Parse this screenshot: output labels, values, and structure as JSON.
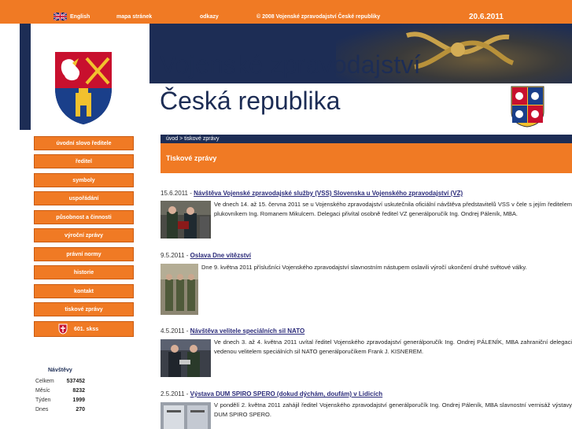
{
  "topbar": {
    "language_label": "English",
    "sitemap_label": "mapa stránek",
    "links_label": "odkazy",
    "copyright": "© 2008 Vojenské zpravodajství České republiky",
    "date": "20.6.2011"
  },
  "header": {
    "title_line1": "Vojenské zpravodajství",
    "title_line2": "Česká republika"
  },
  "nav": {
    "items": [
      {
        "label": "úvodní slovo ředitele"
      },
      {
        "label": "ředitel"
      },
      {
        "label": "symboly"
      },
      {
        "label": "uspořádání"
      },
      {
        "label": "působnost a činnosti"
      },
      {
        "label": "výroční zprávy"
      },
      {
        "label": "právní normy"
      },
      {
        "label": "historie"
      },
      {
        "label": "kontakt"
      },
      {
        "label": "tiskové zprávy"
      },
      {
        "label": "601. skss"
      }
    ]
  },
  "stats": {
    "heading": "Návštěvy",
    "rows": [
      {
        "label": "Celkem",
        "value": "537452"
      },
      {
        "label": "Měsíc",
        "value": "8232"
      },
      {
        "label": "Týden",
        "value": "1999"
      },
      {
        "label": "Dnes",
        "value": "270"
      }
    ]
  },
  "breadcrumb": "úvod > tiskové zprávy",
  "section_title": "Tiskové zprávy",
  "news": [
    {
      "date": "15.6.2011 - ",
      "title": "Návštěva Vojenské zpravodajské služby (VSS) Slovenska u Vojenského zpravodajství (VZ)",
      "body": "Ve dnech 14. až 15. června 2011 se u Vojenského zpravodajství uskutečnila oficiální návštěva představitelů VSS v čele s jejím ředitelem plukovníkem Ing. Romanem Mikulcem. Delegaci přivítal osobně ředitel VZ generálporučík Ing. Ondrej Páleník, MBA."
    },
    {
      "date": "9.5.2011 - ",
      "title": "Oslava Dne vítězství",
      "body": "Dne 9. května 2011 příslušníci Vojenského zpravodajství slavnostním nástupem oslavili výročí ukončení druhé světové války."
    },
    {
      "date": "4.5.2011 - ",
      "title": "Návštěva velitele speciálních sil NATO",
      "body": "Ve dnech 3. až 4. května 2011 uvítal ředitel Vojenského zpravodajství generálporučík Ing. Ondrej PÁLENÍK, MBA zahraniční delegaci vedenou velitelem speciálních sil NATO generálporučíkem Frank J. KISNEREM."
    },
    {
      "date": "2.5.2011 - ",
      "title": "Výstava DUM SPIRO SPERO (dokud dýchám, doufám) v Lidicích",
      "body": "V pondělí 2. května 2011 zahájil ředitel Vojenského zpravodajství generálporučík Ing. Ondrej Páleník, MBA slavnostní vernisáž výstavy DUM SPIRO SPERO."
    }
  ],
  "colors": {
    "orange": "#f07a24",
    "navy": "#1d2d55"
  }
}
